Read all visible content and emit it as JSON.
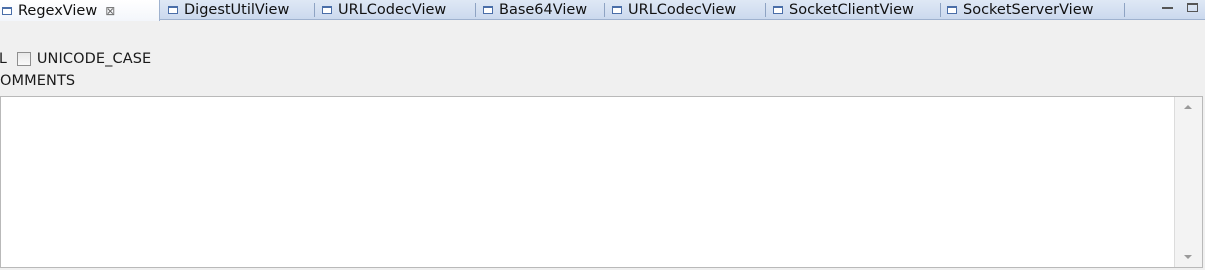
{
  "tabs": [
    {
      "label": "RegexView",
      "active": true,
      "close": "⊠"
    },
    {
      "label": "DigestUtilView"
    },
    {
      "label": "URLCodecView"
    },
    {
      "label": "Base64View"
    },
    {
      "label": "URLCodecView"
    },
    {
      "label": "SocketClientView"
    },
    {
      "label": "SocketServerView"
    }
  ],
  "options": {
    "row1_fragment": "L",
    "unicode_case_label": "UNICODE_CASE",
    "row2_fragment": "OMMENTS"
  },
  "editor": {
    "value": ""
  },
  "colors": {
    "tabbar": "#cbd9ee",
    "accent": "#4a6ea8"
  }
}
